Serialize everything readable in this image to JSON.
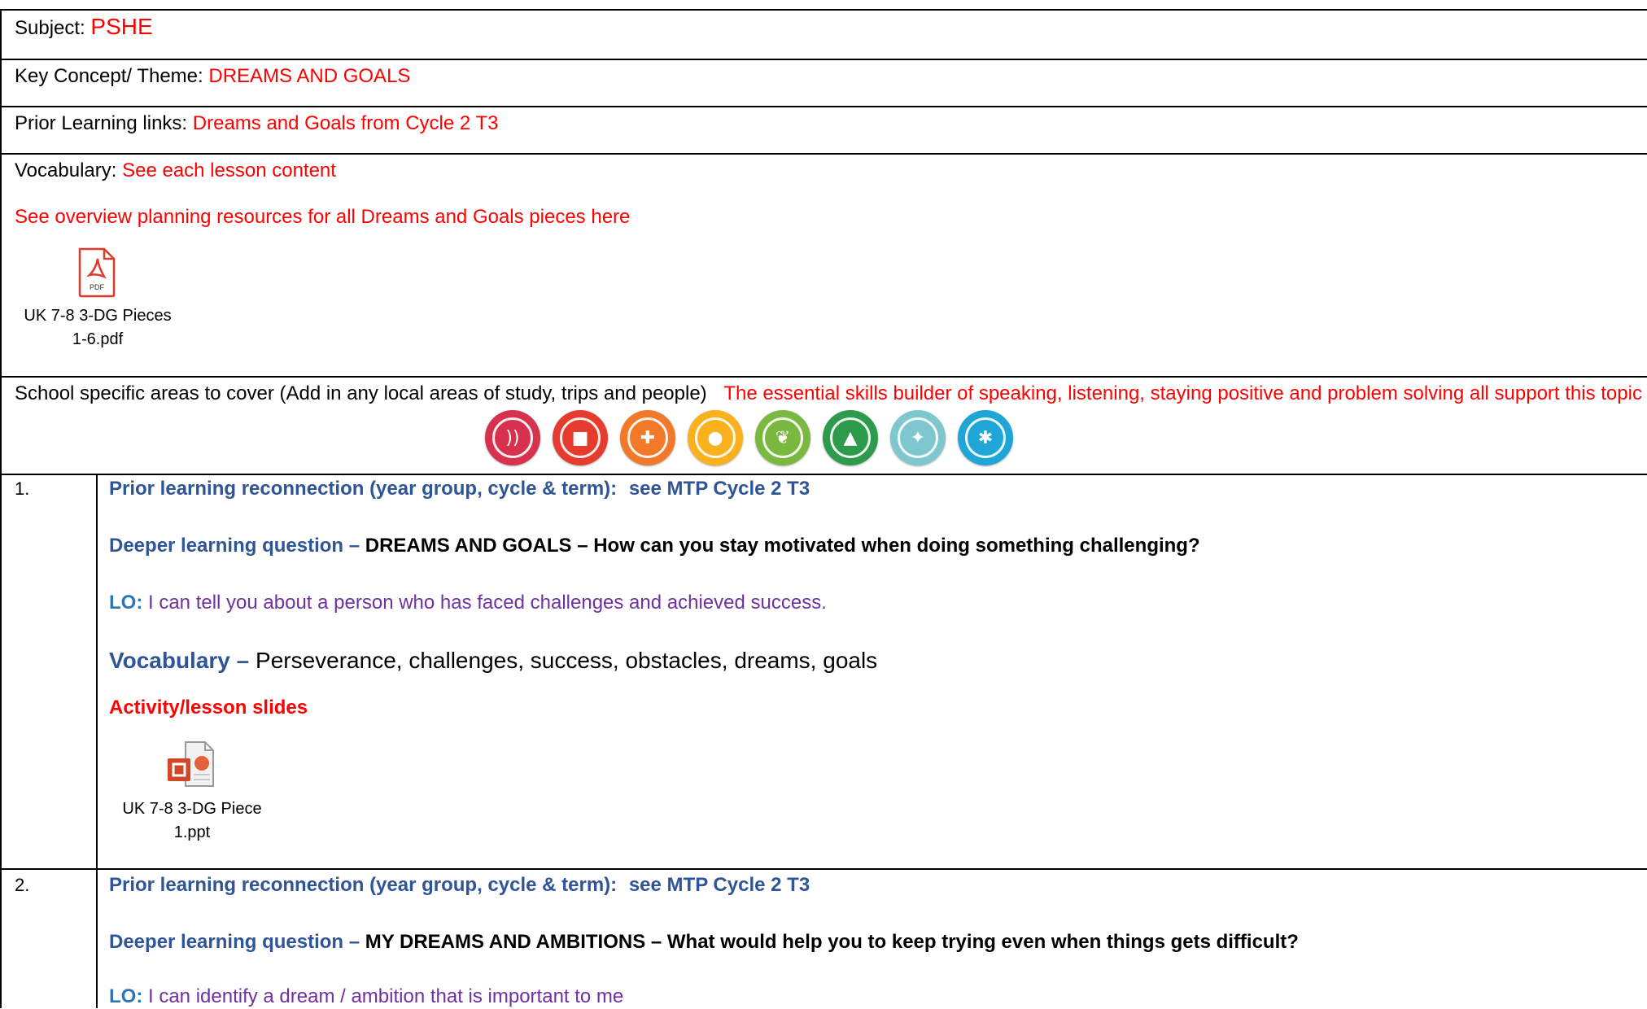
{
  "header": {
    "subject_label": "Subject:",
    "subject_value": "PSHE",
    "theme_label": "Key Concept/ Theme:",
    "theme_value": "DREAMS AND GOALS",
    "prior_label": "Prior Learning links:",
    "prior_value": "Dreams and Goals from Cycle 2 T3",
    "vocab_label": "Vocabulary:",
    "vocab_value": "See each lesson content",
    "overview_link": "See overview planning resources for all Dreams and Goals pieces here"
  },
  "overview_attachment": {
    "icon": "pdf-file-icon",
    "icon_text": "PDF",
    "name_line1": "UK 7-8 3-DG Pieces",
    "name_line2": "1-6.pdf"
  },
  "school_specific": {
    "label": "School specific areas to cover (Add in any local areas of study, trips and people)",
    "note": "The essential skills builder of speaking, listening, staying positive and problem solving all support this topic",
    "badges": [
      {
        "name": "LISTENING",
        "color": "#d6324e",
        "glyph": "))"
      },
      {
        "name": "SPEAKING",
        "color": "#e63c2f",
        "glyph": "■"
      },
      {
        "name": "PROBLEM SOLVING",
        "color": "#f07a2a",
        "glyph": "✚"
      },
      {
        "name": "CREATIVITY",
        "color": "#f9b11e",
        "glyph": "●"
      },
      {
        "name": "STAYING POSITIVE",
        "color": "#7ab840",
        "glyph": "❦"
      },
      {
        "name": "AIMING HIGH",
        "color": "#2e9a4b",
        "glyph": "▲"
      },
      {
        "name": "LEADERSHIP",
        "color": "#7fc7cf",
        "glyph": "✦"
      },
      {
        "name": "TEAMWORK",
        "color": "#1fa6d6",
        "glyph": "✱"
      }
    ]
  },
  "lessons": [
    {
      "number": "1.",
      "prior_label": "Prior learning reconnection (year group, cycle & term):",
      "prior_value": "see MTP Cycle 2 T3",
      "deeper_label": "Deeper learning question –",
      "deeper_value": "DREAMS AND GOALS – How can you stay motivated when doing something challenging?",
      "lo_label": "LO:",
      "lo_value": "I can tell you about a person who has faced challenges and achieved success.",
      "vocab_label": "Vocabulary –",
      "vocab_value": "Perseverance, challenges, success, obstacles, dreams, goals",
      "activity_label": "Activity/lesson slides",
      "attachment": {
        "icon": "powerpoint-file-icon",
        "name_line1": "UK 7-8 3-DG Piece",
        "name_line2": "1.ppt"
      }
    },
    {
      "number": "2.",
      "prior_label": "Prior learning reconnection (year group, cycle & term):",
      "prior_value": "see MTP Cycle 2 T3",
      "deeper_label": "Deeper learning question –",
      "deeper_value": "MY DREAMS AND AMBITIONS – What would help you to keep trying even when things gets difficult?",
      "lo_label": "LO:",
      "lo_value": "I can identify a dream / ambition that is important to me"
    }
  ]
}
